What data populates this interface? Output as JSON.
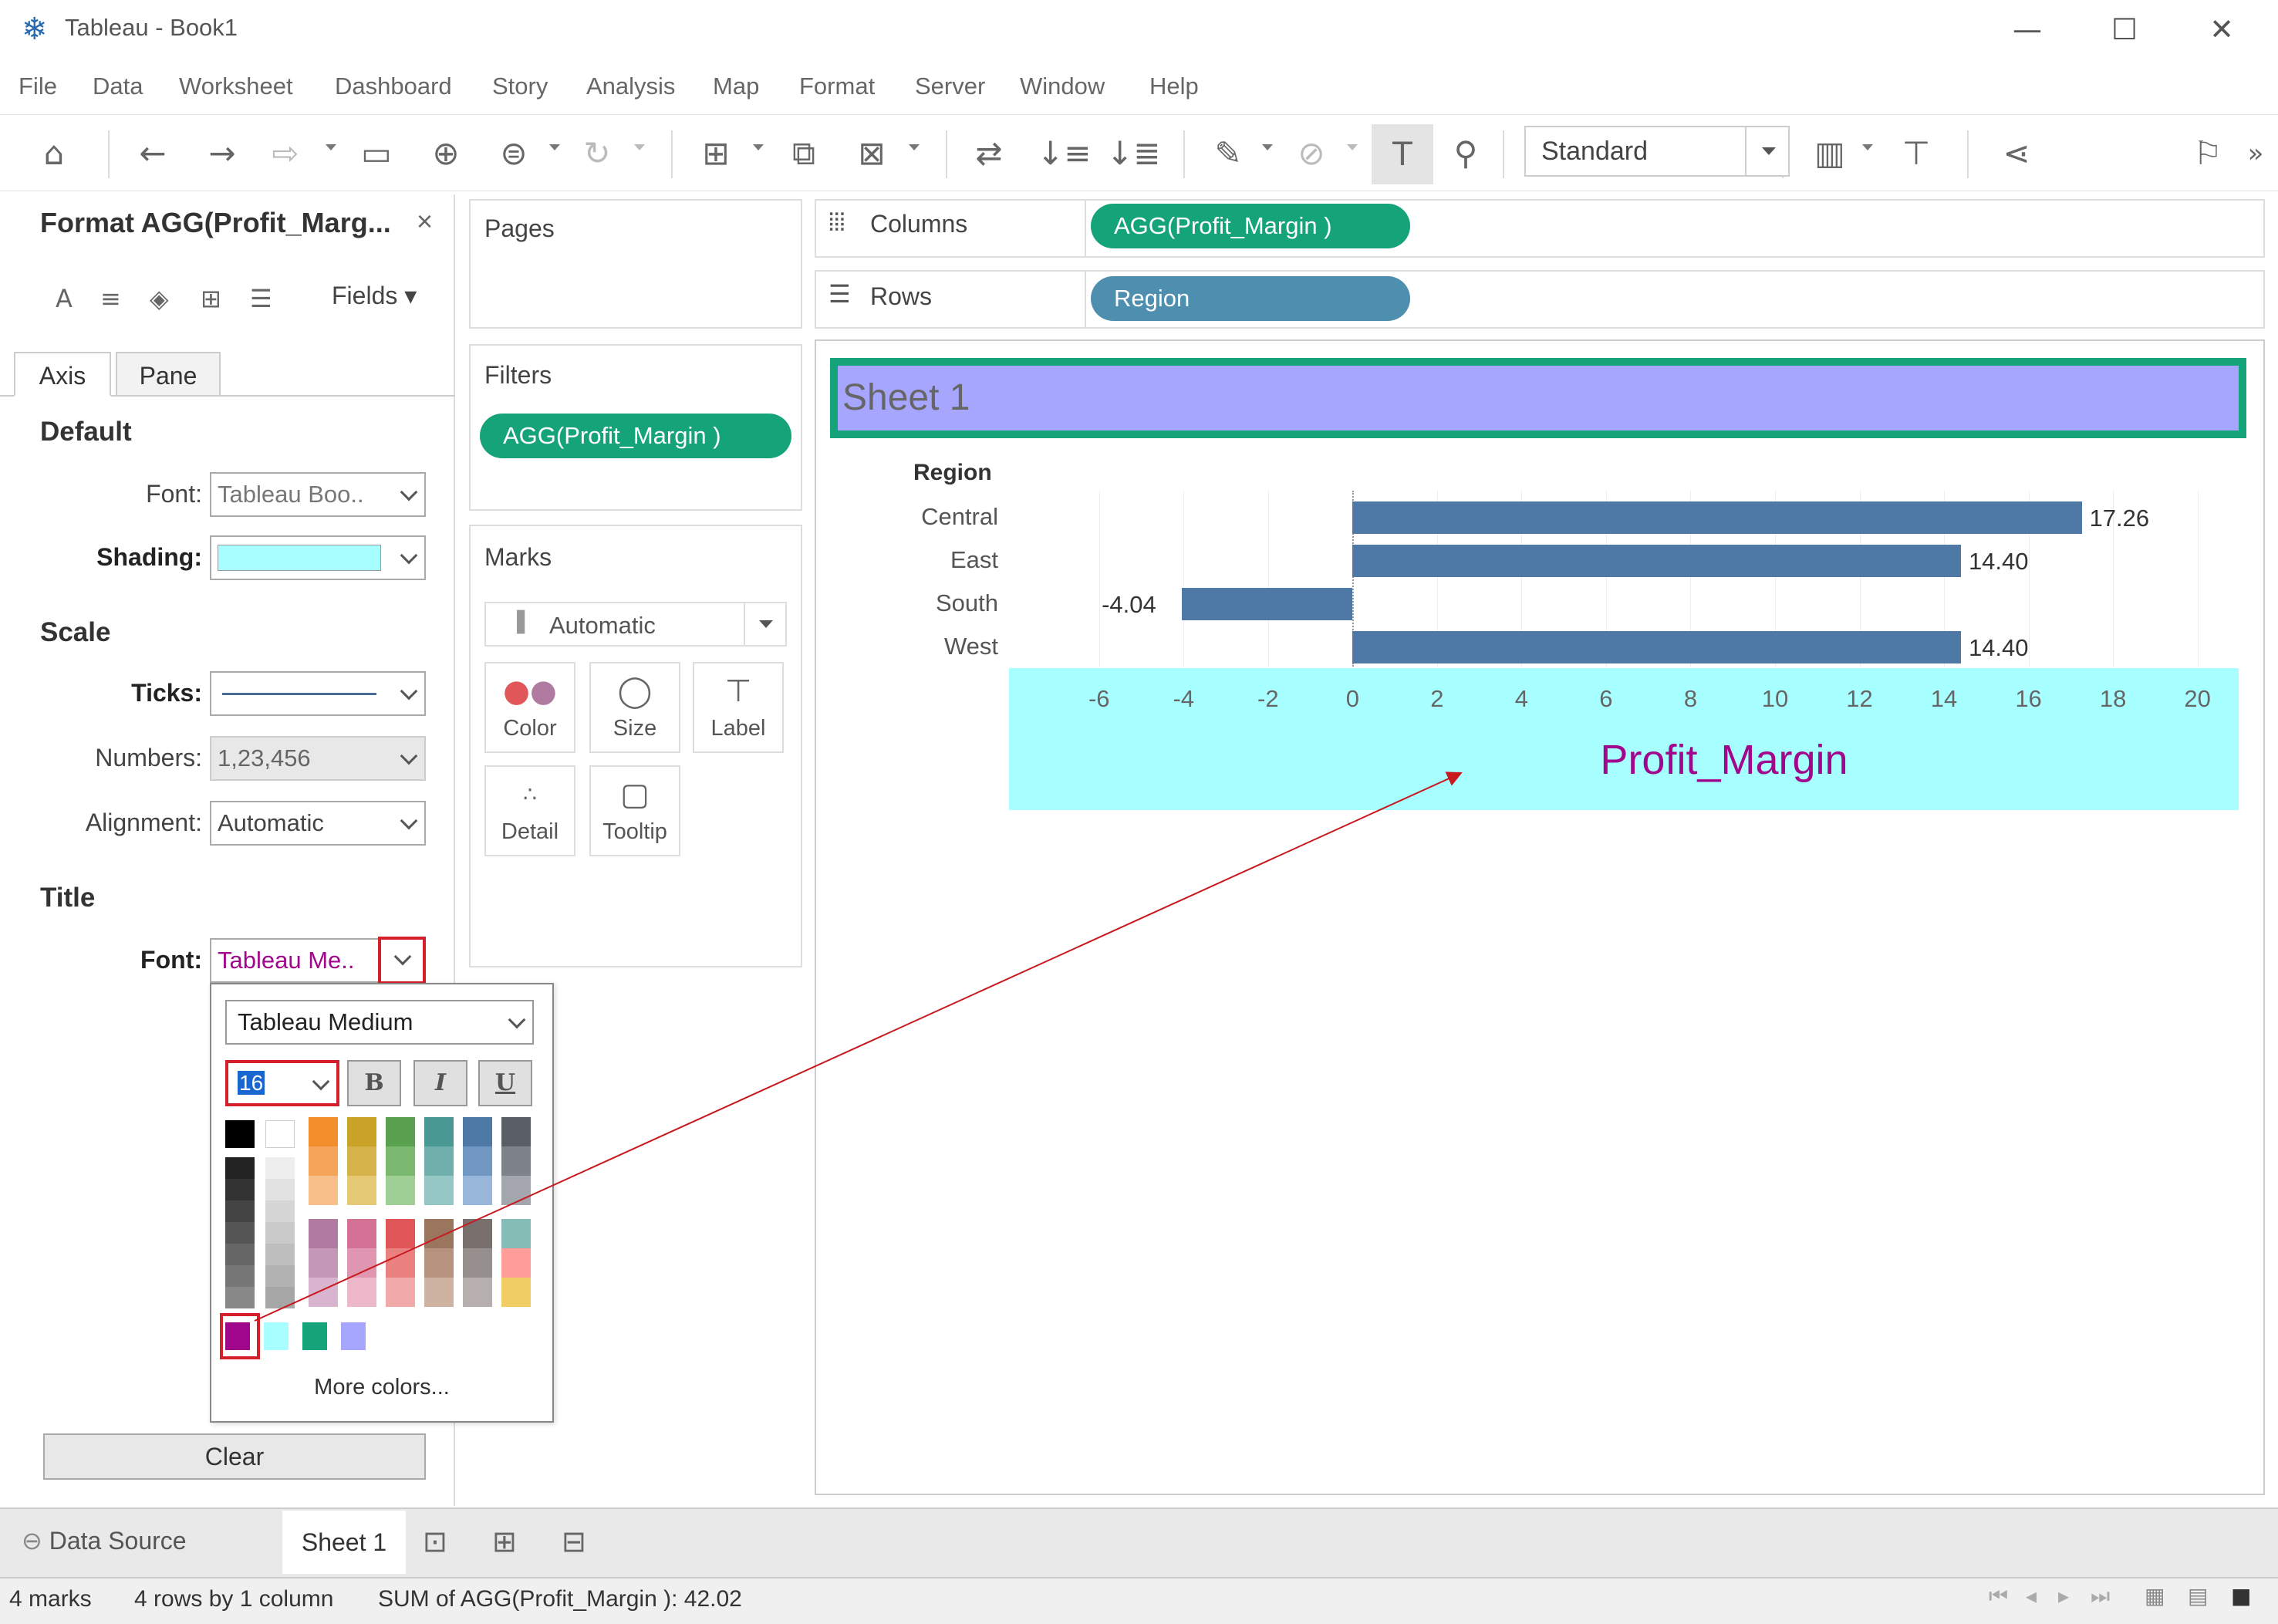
{
  "window": {
    "title": "Tableau - Book1",
    "app_icon": "tableau-icon",
    "controls": [
      "—",
      "☐",
      "✕"
    ]
  },
  "menu": [
    "File",
    "Data",
    "Worksheet",
    "Dashboard",
    "Story",
    "Analysis",
    "Map",
    "Format",
    "Server",
    "Window",
    "Help"
  ],
  "toolbar": {
    "fit_select": "Standard",
    "more": "»"
  },
  "format_pane": {
    "title": "Format AGG(Profit_Marg...",
    "close": "×",
    "fields_label": "Fields ▾",
    "tabs": [
      "Axis",
      "Pane"
    ],
    "default_section": {
      "heading": "Default",
      "font_label": "Font:",
      "font_value": "Tableau Boo..",
      "shading_label": "Shading:",
      "shading_color": "#a8ffff"
    },
    "scale_section": {
      "heading": "Scale",
      "ticks_label": "Ticks:",
      "numbers_label": "Numbers:",
      "numbers_value": "1,23,456",
      "alignment_label": "Alignment:",
      "alignment_value": "Automatic"
    },
    "title_section": {
      "heading": "Title",
      "font_label": "Font:",
      "font_value": "Tableau Me..",
      "font_color": "#a0078c"
    },
    "clear_label": "Clear"
  },
  "font_popup": {
    "font_name": "Tableau Medium",
    "font_size": "16",
    "bold": "B",
    "italic": "I",
    "underline": "U",
    "more_colors": "More colors...",
    "recent_colors": [
      "#a0078c",
      "#a8ffff",
      "#15a37a",
      "#a6a6ff"
    ]
  },
  "shelves": {
    "pages_label": "Pages",
    "filters_label": "Filters",
    "filter_pill": "AGG(Profit_Margin )",
    "marks_label": "Marks",
    "mark_type": "Automatic",
    "mark_buttons": [
      "Color",
      "Size",
      "Label",
      "Detail",
      "Tooltip"
    ],
    "columns_label": "Columns",
    "columns_pill": "AGG(Profit_Margin )",
    "rows_label": "Rows",
    "rows_pill": "Region"
  },
  "sheet": {
    "title": "Sheet 1",
    "title_background": "#a6a6ff",
    "title_border": "#15a37a"
  },
  "chart_data": {
    "type": "bar",
    "orientation": "horizontal",
    "row_header": "Region",
    "categories": [
      "Central",
      "East",
      "South",
      "West"
    ],
    "values": [
      17.26,
      14.4,
      -4.04,
      14.4
    ],
    "value_labels": [
      "17.26",
      "14.40",
      "-4.04",
      "14.40"
    ],
    "xlabel": "Profit_Margin",
    "xlim": [
      -7,
      20.5
    ],
    "ticks": [
      -6,
      -4,
      -2,
      0,
      2,
      4,
      6,
      8,
      10,
      12,
      14,
      16,
      18,
      20
    ],
    "bar_color": "#4e79a7",
    "axis_shading": "#a8ffff",
    "axis_title_color": "#a0078c",
    "axis_title_size": "16"
  },
  "bottom_tabs": {
    "data_source": "Data Source",
    "sheet": "Sheet 1"
  },
  "status": {
    "marks": "4 marks",
    "rows_cols": "4 rows by 1 column",
    "sum": "SUM of AGG(Profit_Margin ): 42.02"
  }
}
